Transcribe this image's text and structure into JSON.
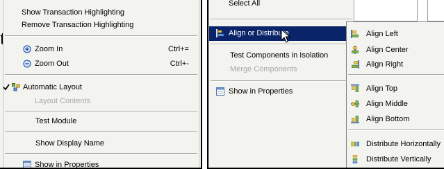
{
  "left_menu": {
    "show_transaction_highlighting": "Show Transaction Highlighting",
    "remove_transaction_highlighting": "Remove Transaction Highlighting",
    "zoom_in": "Zoom In",
    "zoom_in_shortcut": "Ctrl+=",
    "zoom_out": "Zoom Out",
    "zoom_out_shortcut": "Ctrl+-",
    "automatic_layout": "Automatic Layout",
    "layout_contents": "Layout Contents",
    "test_module": "Test Module",
    "show_display_name": "Show Display Name",
    "show_in_properties": "Show in Properties"
  },
  "right_menu": {
    "select_all": "Select All",
    "align_or_distribute": "Align or Distribute",
    "test_components_in_isolation": "Test Components in Isolation",
    "merge_components": "Merge Components",
    "show_in_properties": "Show in Properties"
  },
  "submenu": {
    "align_left": "Align Left",
    "align_center": "Align Center",
    "align_right": "Align Right",
    "align_top": "Align Top",
    "align_middle": "Align Middle",
    "align_bottom": "Align Bottom",
    "distribute_horizontally": "Distribute Horizontally",
    "distribute_vertically": "Distribute Vertically"
  },
  "colors": {
    "menu_background": "#f3f3ef",
    "selection": "#0a246a",
    "disabled_text": "#a8a8a8"
  },
  "icons": {
    "zoom_in": "zoom-in-icon",
    "zoom_out": "zoom-out-icon",
    "automatic_layout": "layout-icon",
    "checkmark": "checkmark-icon",
    "properties": "properties-icon",
    "align_or_distribute": "align-icon",
    "cursor": "mouse-cursor-icon"
  }
}
